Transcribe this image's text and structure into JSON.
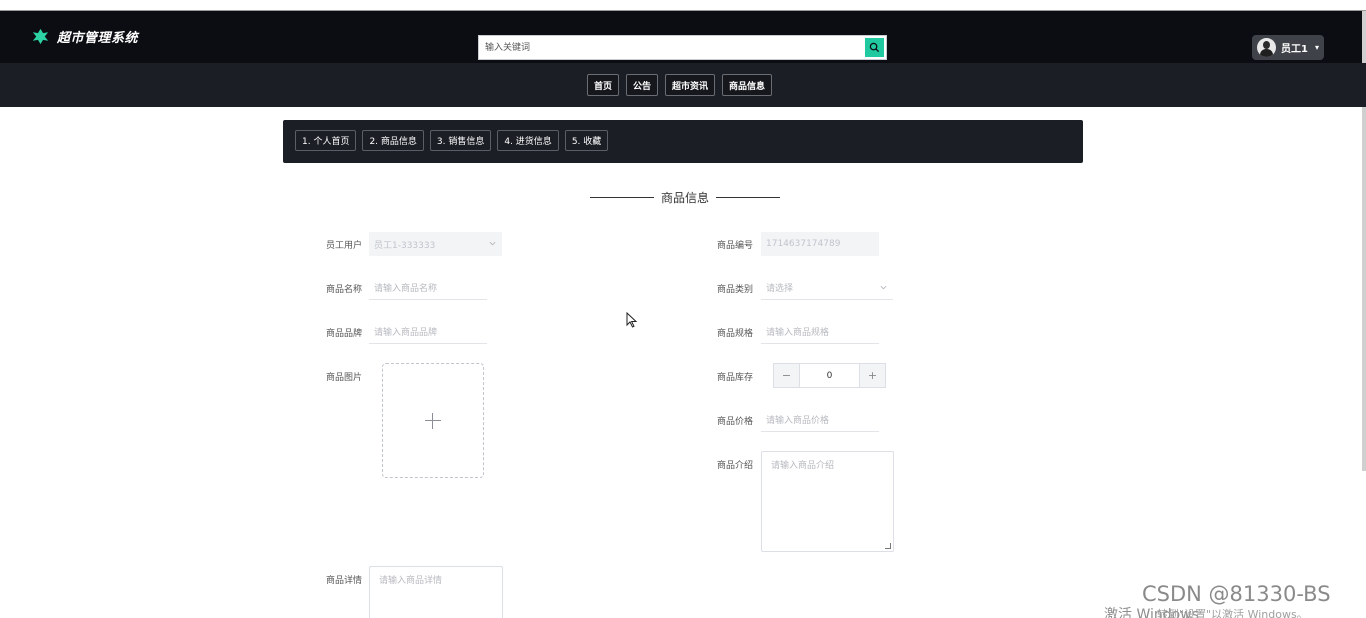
{
  "app": {
    "title": "超市管理系统"
  },
  "search": {
    "placeholder": "输入关键词"
  },
  "user": {
    "name": "员工1"
  },
  "nav": {
    "items": [
      "首页",
      "公告",
      "超市资讯",
      "商品信息"
    ]
  },
  "subnav": {
    "items": [
      "1. 个人首页",
      "2. 商品信息",
      "3. 销售信息",
      "4. 进货信息",
      "5. 收藏"
    ]
  },
  "form": {
    "title": "商品信息",
    "employee_user": {
      "label": "员工用户",
      "value": "员工1-333333"
    },
    "product_no": {
      "label": "商品编号",
      "value": "1714637174789"
    },
    "product_name": {
      "label": "商品名称",
      "placeholder": "请输入商品名称"
    },
    "category": {
      "label": "商品类别",
      "placeholder": "请选择"
    },
    "brand": {
      "label": "商品品牌",
      "placeholder": "请输入商品品牌"
    },
    "spec": {
      "label": "商品规格",
      "placeholder": "请输入商品规格"
    },
    "image": {
      "label": "商品图片"
    },
    "stock": {
      "label": "商品库存",
      "value": "0",
      "minus": "−",
      "plus": "+"
    },
    "price": {
      "label": "商品价格",
      "placeholder": "请输入商品价格"
    },
    "intro": {
      "label": "商品介绍",
      "placeholder": "请输入商品介绍"
    },
    "detail": {
      "label": "商品详情",
      "placeholder": "请输入商品详情"
    }
  },
  "watermark": {
    "csdn": "CSDN @81330-BS",
    "activate_line1": "激活 Windows",
    "activate_line2": "转到\"设置\"以激活 Windows。"
  },
  "colors": {
    "header_bg": "#0b0d12",
    "nav_bg": "#1b1e25",
    "accent": "#20c9a0"
  }
}
